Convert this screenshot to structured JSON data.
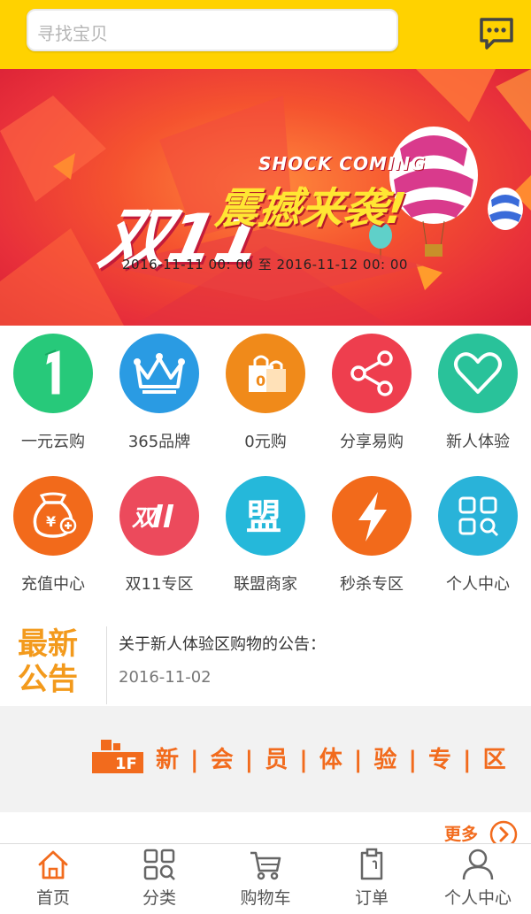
{
  "header": {
    "search_placeholder": "寻找宝贝",
    "message_icon": "message-icon"
  },
  "banner": {
    "big_text": "双11",
    "english_text": "SHOCK COMING",
    "chinese_text": "震撼来袭!",
    "date_range": "2016-11-11  00:  00 至 2016-11-12  00:  00"
  },
  "grid": [
    {
      "label": "一元云购",
      "icon": "one-icon",
      "color": "#27c97a"
    },
    {
      "label": "365品牌",
      "icon": "crown-icon",
      "color": "#2a9be3"
    },
    {
      "label": "0元购",
      "icon": "bag-icon",
      "color": "#f08a1a"
    },
    {
      "label": "分享易购",
      "icon": "share-icon",
      "color": "#ee3e4e"
    },
    {
      "label": "新人体验",
      "icon": "heart-icon",
      "color": "#29c29a"
    },
    {
      "label": "充值中心",
      "icon": "moneybag-icon",
      "color": "#f26a1b"
    },
    {
      "label": "双11专区",
      "icon": "double11-icon",
      "color": "#ec4a5c"
    },
    {
      "label": "联盟商家",
      "icon": "alliance-icon",
      "color": "#25b8da"
    },
    {
      "label": "秒杀专区",
      "icon": "lightning-icon",
      "color": "#f26a1b"
    },
    {
      "label": "个人中心",
      "icon": "grid-search-icon",
      "color": "#29b3d9"
    }
  ],
  "notice": {
    "tag_line1": "最新",
    "tag_line2": "公告",
    "title": "关于新人体验区购物的公告：",
    "date": "2016-11-02"
  },
  "floor": {
    "badge": "1F",
    "title": "新 | 会 | 员 | 体 | 验 | 专 | 区"
  },
  "more": {
    "label": "更多"
  },
  "tabbar": [
    {
      "label": "首页",
      "icon": "home-icon",
      "active": true
    },
    {
      "label": "分类",
      "icon": "category-icon",
      "active": false
    },
    {
      "label": "购物车",
      "icon": "cart-icon",
      "active": false
    },
    {
      "label": "订单",
      "icon": "order-icon",
      "active": false
    },
    {
      "label": "个人中心",
      "icon": "user-icon",
      "active": false
    }
  ],
  "colors": {
    "header_bg": "#ffd200",
    "accent": "#f26b1d",
    "notice_tag": "#f39a1c"
  }
}
